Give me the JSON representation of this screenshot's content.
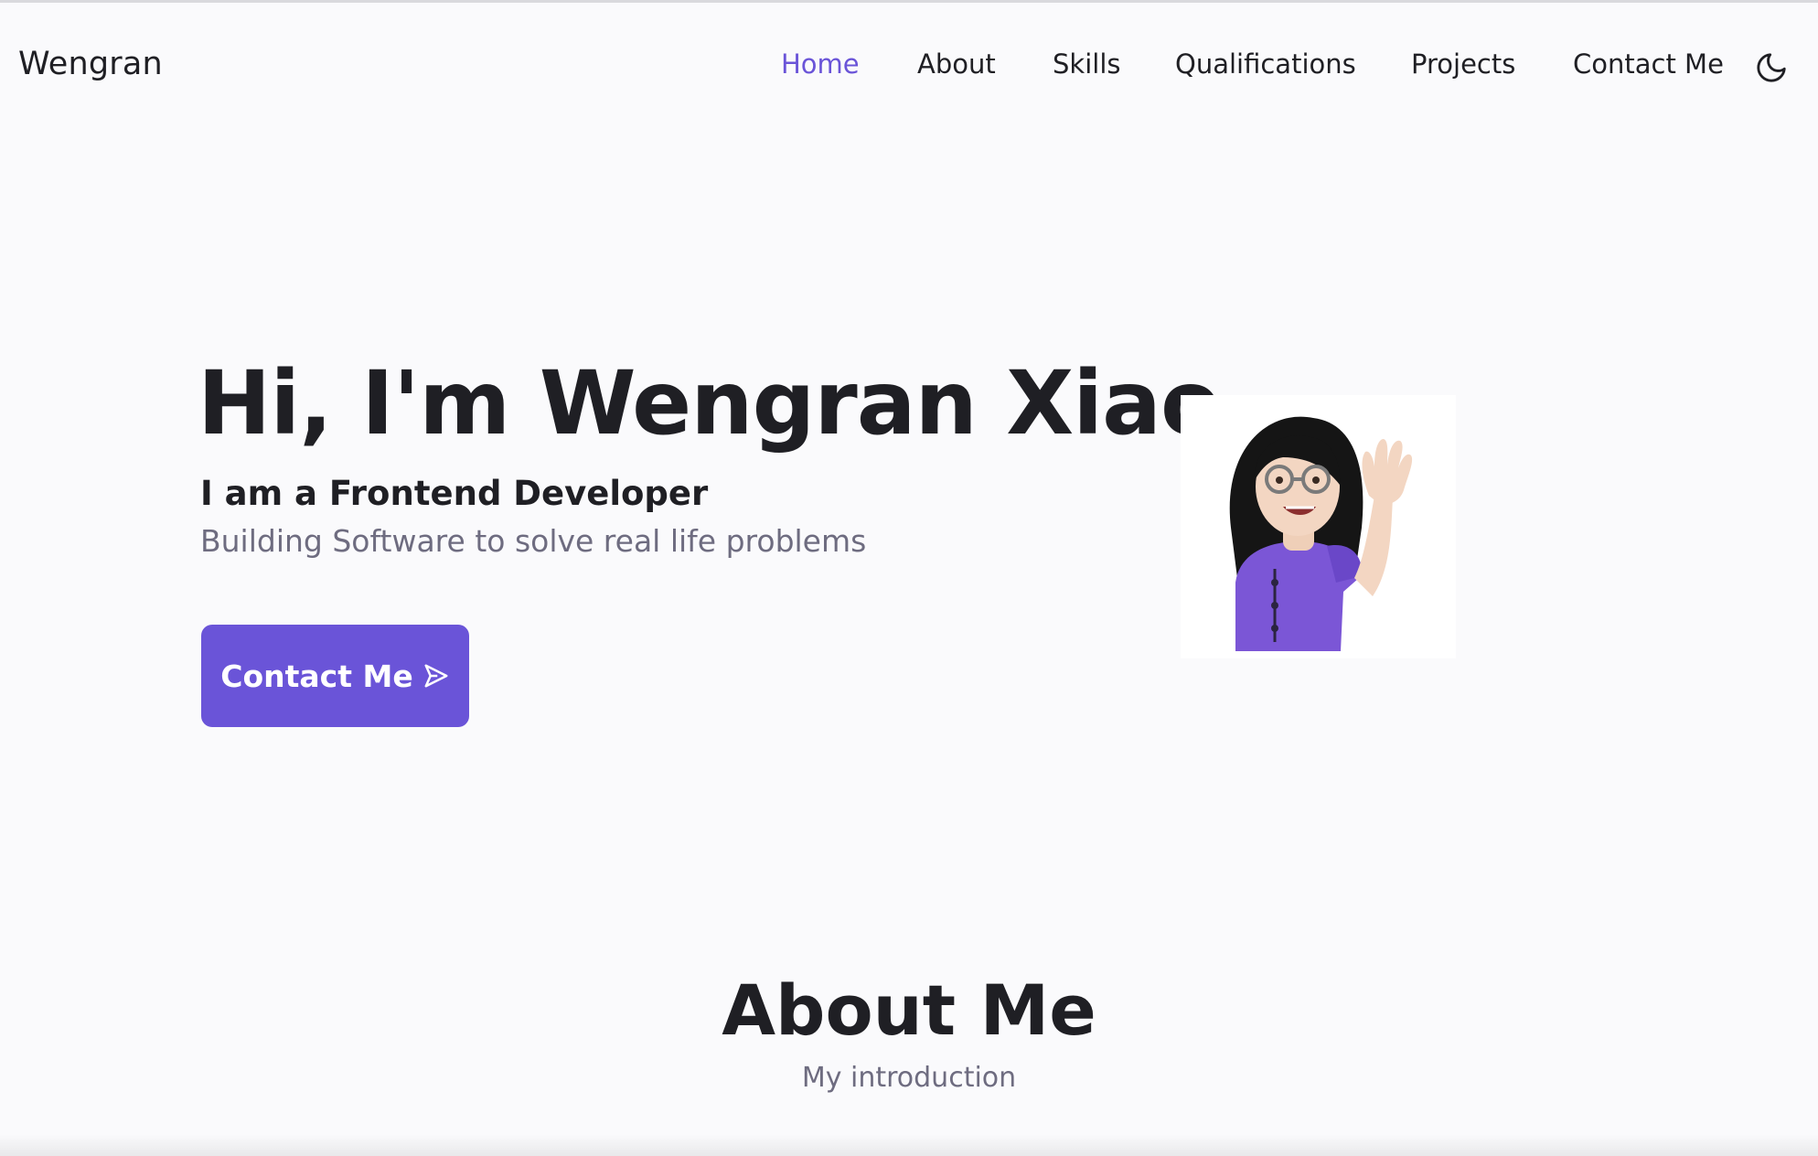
{
  "header": {
    "logo": "Wengran",
    "nav": [
      {
        "label": "Home",
        "active": true
      },
      {
        "label": "About",
        "active": false
      },
      {
        "label": "Skills",
        "active": false
      },
      {
        "label": "Qualifications",
        "active": false
      },
      {
        "label": "Projects",
        "active": false
      },
      {
        "label": "Contact Me",
        "active": false
      }
    ],
    "theme_icon": "moon-icon"
  },
  "hero": {
    "title": "Hi, I'm Wengran Xiao",
    "subtitle": "I am a Frontend Developer",
    "description": "Building Software to solve real life problems",
    "button_label": "Contact Me",
    "button_icon": "send-icon",
    "avatar_icon": "memoji-avatar"
  },
  "about": {
    "title": "About Me",
    "subtitle": "My introduction"
  },
  "colors": {
    "accent": "#6a54d8",
    "text": "#1f1f24",
    "muted": "#6e6c80",
    "background": "#fafafc"
  }
}
